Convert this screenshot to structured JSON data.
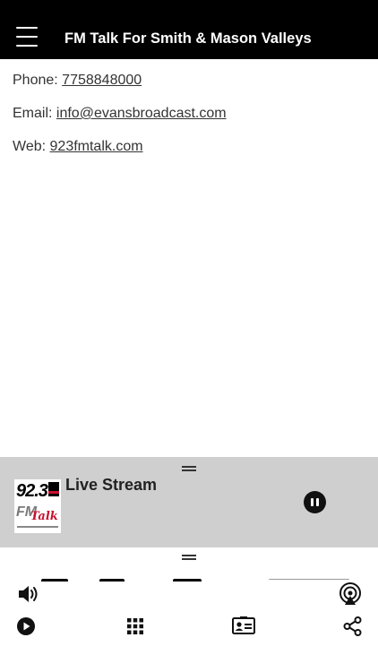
{
  "header": {
    "title": "FM Talk For Smith & Mason Valleys",
    "menu_icon": "hamburger-menu-icon"
  },
  "contact": {
    "phone_label": "Phone:",
    "phone_value": "7758848000",
    "email_label": "Email:",
    "email_value": "info@evansbroadcast.com",
    "web_label": "Web:",
    "web_value": "923fmtalk.com"
  },
  "player": {
    "title": "Live Stream",
    "logo_text": "92.3",
    "logo_fm": "FM",
    "logo_talk": "Talk",
    "state_icon": "pause-icon"
  },
  "toolbar": {
    "icons": [
      "volume-icon",
      "airplay-icon",
      "play-icon",
      "grid-icon",
      "contact-card-icon",
      "share-icon"
    ]
  },
  "colors": {
    "header_bg": "#000000",
    "player_bg": "#cfcfcf",
    "accent_red": "#c8102e"
  }
}
